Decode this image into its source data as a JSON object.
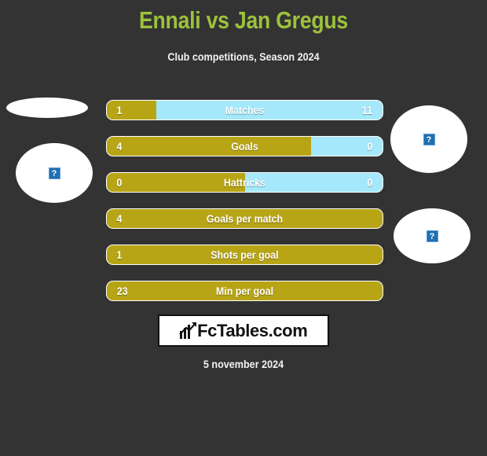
{
  "header": {
    "title": "Ennali vs Jan Gregus",
    "subtitle": "Club competitions, Season 2024",
    "title_color": "#9cc23c",
    "subtitle_color": "#ffffff"
  },
  "theme": {
    "background": "#333333",
    "home_color": "#b8a516",
    "away_color": "#a5e8fb",
    "outline": "#ffffff"
  },
  "placeholders": {
    "icon": "broken-image-icon",
    "glyph": "?",
    "left": [
      "home-player-flag",
      "home-player-photo"
    ],
    "right": [
      "away-player-photo",
      "away-player-flag"
    ]
  },
  "chart_data": {
    "type": "bar",
    "title": "Ennali vs Jan Gregus",
    "subtitle": "Club competitions, Season 2024",
    "orientation": "horizontal-diverging",
    "series": [
      {
        "name": "Ennali",
        "color": "#b8a516"
      },
      {
        "name": "Jan Gregus",
        "color": "#a5e8fb"
      }
    ],
    "categories": [
      "Matches",
      "Goals",
      "Hattricks",
      "Goals per match",
      "Shots per goal",
      "Min per goal"
    ],
    "rows": [
      {
        "label": "Matches",
        "left_value": "1",
        "right_value": "11",
        "left_pct": 18,
        "split": true
      },
      {
        "label": "Goals",
        "left_value": "4",
        "right_value": "0",
        "left_pct": 74,
        "split": true
      },
      {
        "label": "Hattricks",
        "left_value": "0",
        "right_value": "0",
        "left_pct": 50,
        "split": true
      },
      {
        "label": "Goals per match",
        "left_value": "4",
        "right_value": "",
        "left_pct": 100,
        "split": false
      },
      {
        "label": "Shots per goal",
        "left_value": "1",
        "right_value": "",
        "left_pct": 100,
        "split": false
      },
      {
        "label": "Min per goal",
        "left_value": "23",
        "right_value": "",
        "left_pct": 100,
        "split": false
      }
    ]
  },
  "logo": {
    "text": "FcTables.com",
    "icon": "bar-chart-icon"
  },
  "footer": {
    "date": "5 november 2024"
  }
}
